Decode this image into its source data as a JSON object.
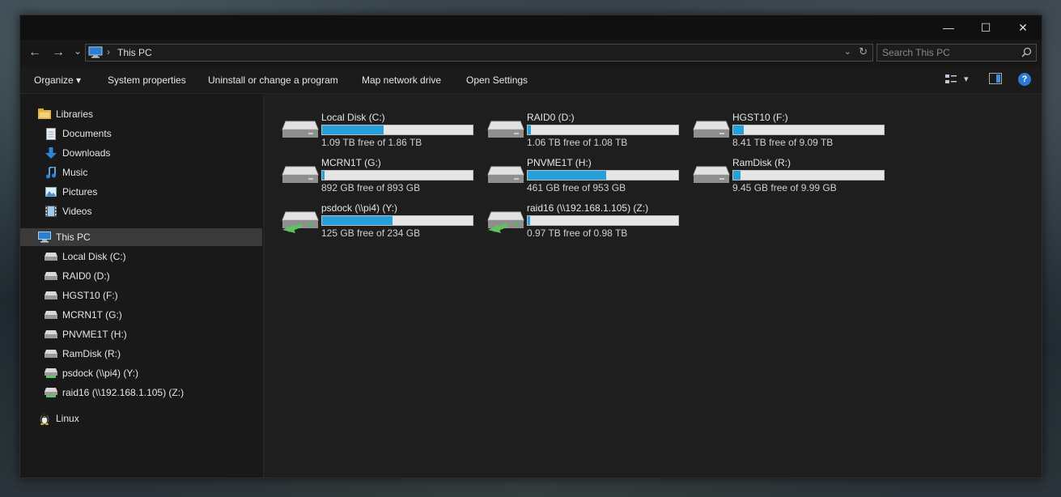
{
  "window": {
    "controls": {
      "minimize": "—",
      "maximize": "☐",
      "close": "✕"
    }
  },
  "address": {
    "back": "←",
    "forward": "→",
    "recent": "⌄",
    "separator": "›",
    "path": "This PC",
    "dropdown": "⌄",
    "refresh": "↻"
  },
  "search": {
    "placeholder": "Search This PC"
  },
  "toolbar": {
    "organize": "Organize",
    "organize_arrow": "▾",
    "system_properties": "System properties",
    "uninstall": "Uninstall or change a program",
    "map_network": "Map network drive",
    "open_settings": "Open Settings",
    "view_arrow": "▾",
    "help": "?"
  },
  "sidebar": {
    "libraries": {
      "label": "Libraries",
      "items": [
        "Documents",
        "Downloads",
        "Music",
        "Pictures",
        "Videos"
      ]
    },
    "this_pc": {
      "label": "This PC",
      "items": [
        "Local Disk (C:)",
        "RAID0 (D:)",
        "HGST10 (F:)",
        "MCRN1T (G:)",
        "PNVME1T (H:)",
        "RamDisk (R:)",
        "psdock (\\\\pi4) (Y:)",
        "raid16 (\\\\192.168.1.105) (Z:)"
      ]
    },
    "linux": {
      "label": "Linux"
    }
  },
  "drives": [
    {
      "name": "Local Disk (C:)",
      "free": "1.09 TB free of 1.86 TB",
      "used_fraction": 0.41,
      "network": false
    },
    {
      "name": "RAID0 (D:)",
      "free": "1.06 TB free of 1.08 TB",
      "used_fraction": 0.02,
      "network": false
    },
    {
      "name": "HGST10 (F:)",
      "free": "8.41 TB free of 9.09 TB",
      "used_fraction": 0.07,
      "network": false
    },
    {
      "name": "MCRN1T (G:)",
      "free": "892 GB free of 893 GB",
      "used_fraction": 0.0,
      "network": false
    },
    {
      "name": "PNVME1T (H:)",
      "free": "461 GB free of 953 GB",
      "used_fraction": 0.52,
      "network": false
    },
    {
      "name": "RamDisk (R:)",
      "free": "9.45 GB free of 9.99 GB",
      "used_fraction": 0.05,
      "network": false
    },
    {
      "name": "psdock (\\\\pi4) (Y:)",
      "free": "125 GB free of 234 GB",
      "used_fraction": 0.47,
      "network": true
    },
    {
      "name": "raid16 (\\\\192.168.1.105) (Z:)",
      "free": "0.97 TB free of 0.98 TB",
      "used_fraction": 0.01,
      "network": true
    }
  ],
  "colors": {
    "bar_fill": "#26a0da",
    "bar_bg": "#e6e6e6"
  }
}
